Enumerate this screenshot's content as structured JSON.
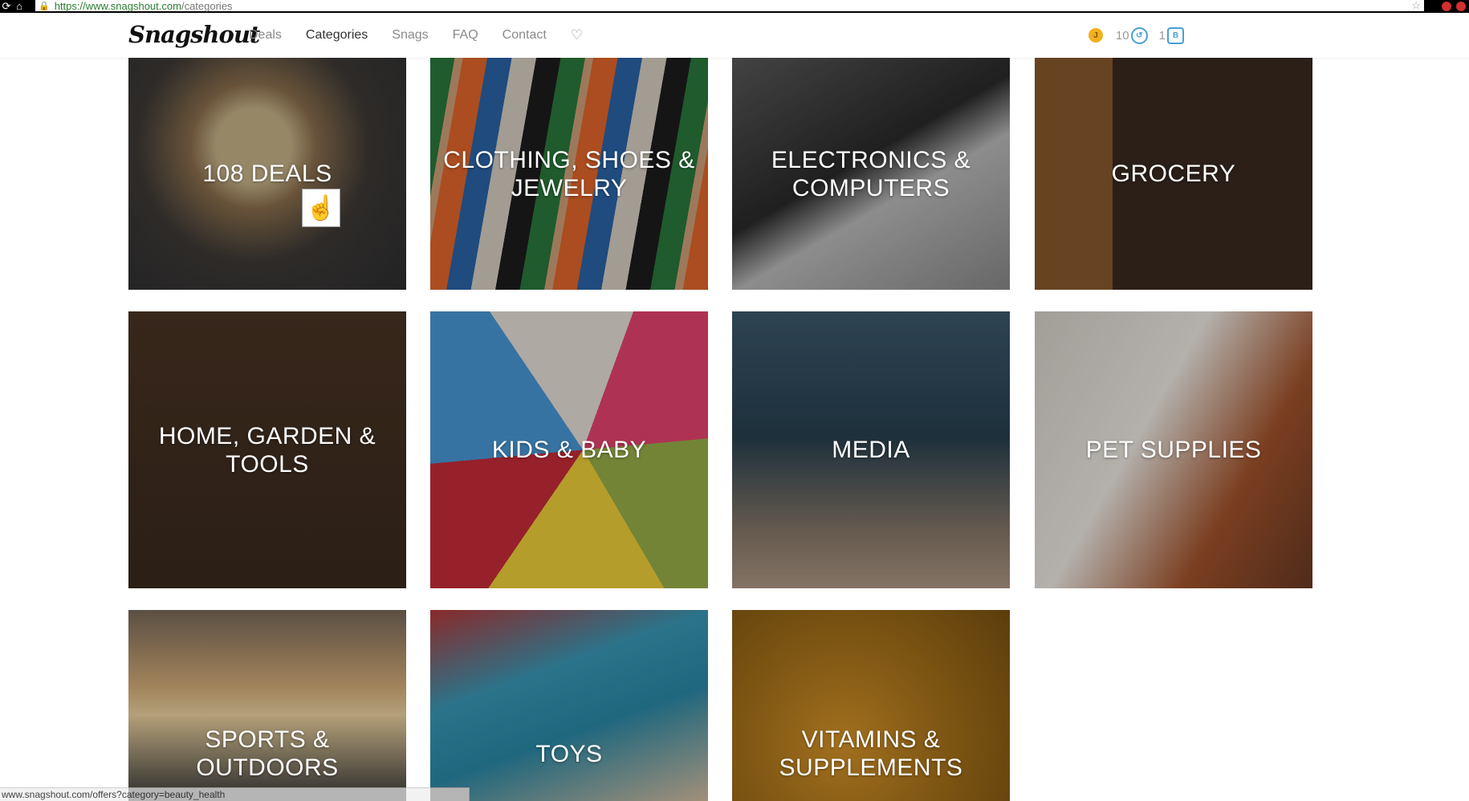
{
  "browser": {
    "url_host": "https://www.snagshout.com",
    "url_path": "/categories",
    "status_text": "www.snagshout.com/offers?category=beauty_health"
  },
  "header": {
    "logo": "Snagshout",
    "nav": [
      "Deals",
      "Categories",
      "Snags",
      "FAQ",
      "Contact"
    ],
    "coin_label": "J",
    "stat1_value": "10",
    "stat2_value": "1",
    "badge_blue_label": "↺",
    "badge_hex_label": "B"
  },
  "categories": [
    {
      "label": "108 DEALS"
    },
    {
      "label": "CLOTHING, SHOES & JEWELRY"
    },
    {
      "label": "ELECTRONICS & COMPUTERS"
    },
    {
      "label": "GROCERY"
    },
    {
      "label": "HOME, GARDEN & TOOLS"
    },
    {
      "label": "KIDS & BABY"
    },
    {
      "label": "MEDIA"
    },
    {
      "label": "PET SUPPLIES"
    },
    {
      "label": "SPORTS & OUTDOORS"
    },
    {
      "label": "TOYS"
    },
    {
      "label": "VITAMINS & SUPPLEMENTS"
    }
  ],
  "colors": {
    "accent_blue": "#46a0d8",
    "coin_gold": "#f2b01e",
    "nav_active": "#333333",
    "nav_inactive": "#8a8a8a"
  }
}
